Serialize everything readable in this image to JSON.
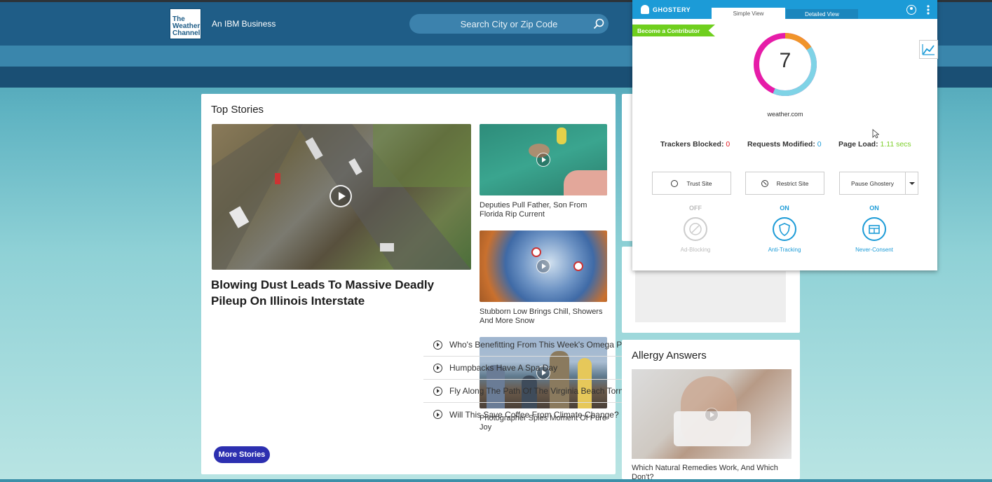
{
  "header": {
    "logo_lines": [
      "The",
      "Weather",
      "Channel"
    ],
    "tagline": "An IBM Business",
    "search_placeholder": "Search City or Zip Code"
  },
  "top_stories": {
    "title": "Top Stories",
    "hero_headline": "Blowing Dust Leads To Massive Deadly Pileup On Illinois Interstate",
    "side_stories": [
      {
        "caption": "Deputies Pull Father, Son From Florida Rip Current"
      },
      {
        "caption": "Stubborn Low Brings Chill, Showers And More Snow"
      },
      {
        "caption": "Photographer Spies Moment Of Pure Joy"
      }
    ],
    "list": [
      "Who's Benefitting From This Week's Omega Pattern?",
      "Humpbacks Have A Spa Day",
      "Fly Along The Path Of The Virginia Beach Tornado",
      "Will This Save Coffee From Climate Change?"
    ],
    "more_button": "More Stories"
  },
  "allergy": {
    "title": "Allergy Answers",
    "caption": "Which Natural Remedies Work, And Which Don't?"
  },
  "ghostery": {
    "brand": "GHOSTERY",
    "tabs": {
      "simple": "Simple View",
      "detailed": "Detailed View"
    },
    "contributor": "Become a Contributor",
    "tracker_count": "7",
    "site": "weather.com",
    "stats": {
      "blocked_label": "Trackers Blocked:",
      "blocked_value": "0",
      "modified_label": "Requests Modified:",
      "modified_value": "0",
      "load_label": "Page Load:",
      "load_value": "1.11 secs"
    },
    "buttons": {
      "trust": "Trust Site",
      "restrict": "Restrict Site",
      "pause": "Pause Ghostery"
    },
    "features": [
      {
        "state": "OFF",
        "label": "Ad-Blocking"
      },
      {
        "state": "ON",
        "label": "Anti-Tracking"
      },
      {
        "state": "ON",
        "label": "Never-Consent"
      }
    ],
    "colors": {
      "accent": "#1c9bd7",
      "on": "#1c9bd7",
      "off": "#bbbbbb",
      "load": "#7ccf2a",
      "blocked": "#e0161e"
    }
  }
}
